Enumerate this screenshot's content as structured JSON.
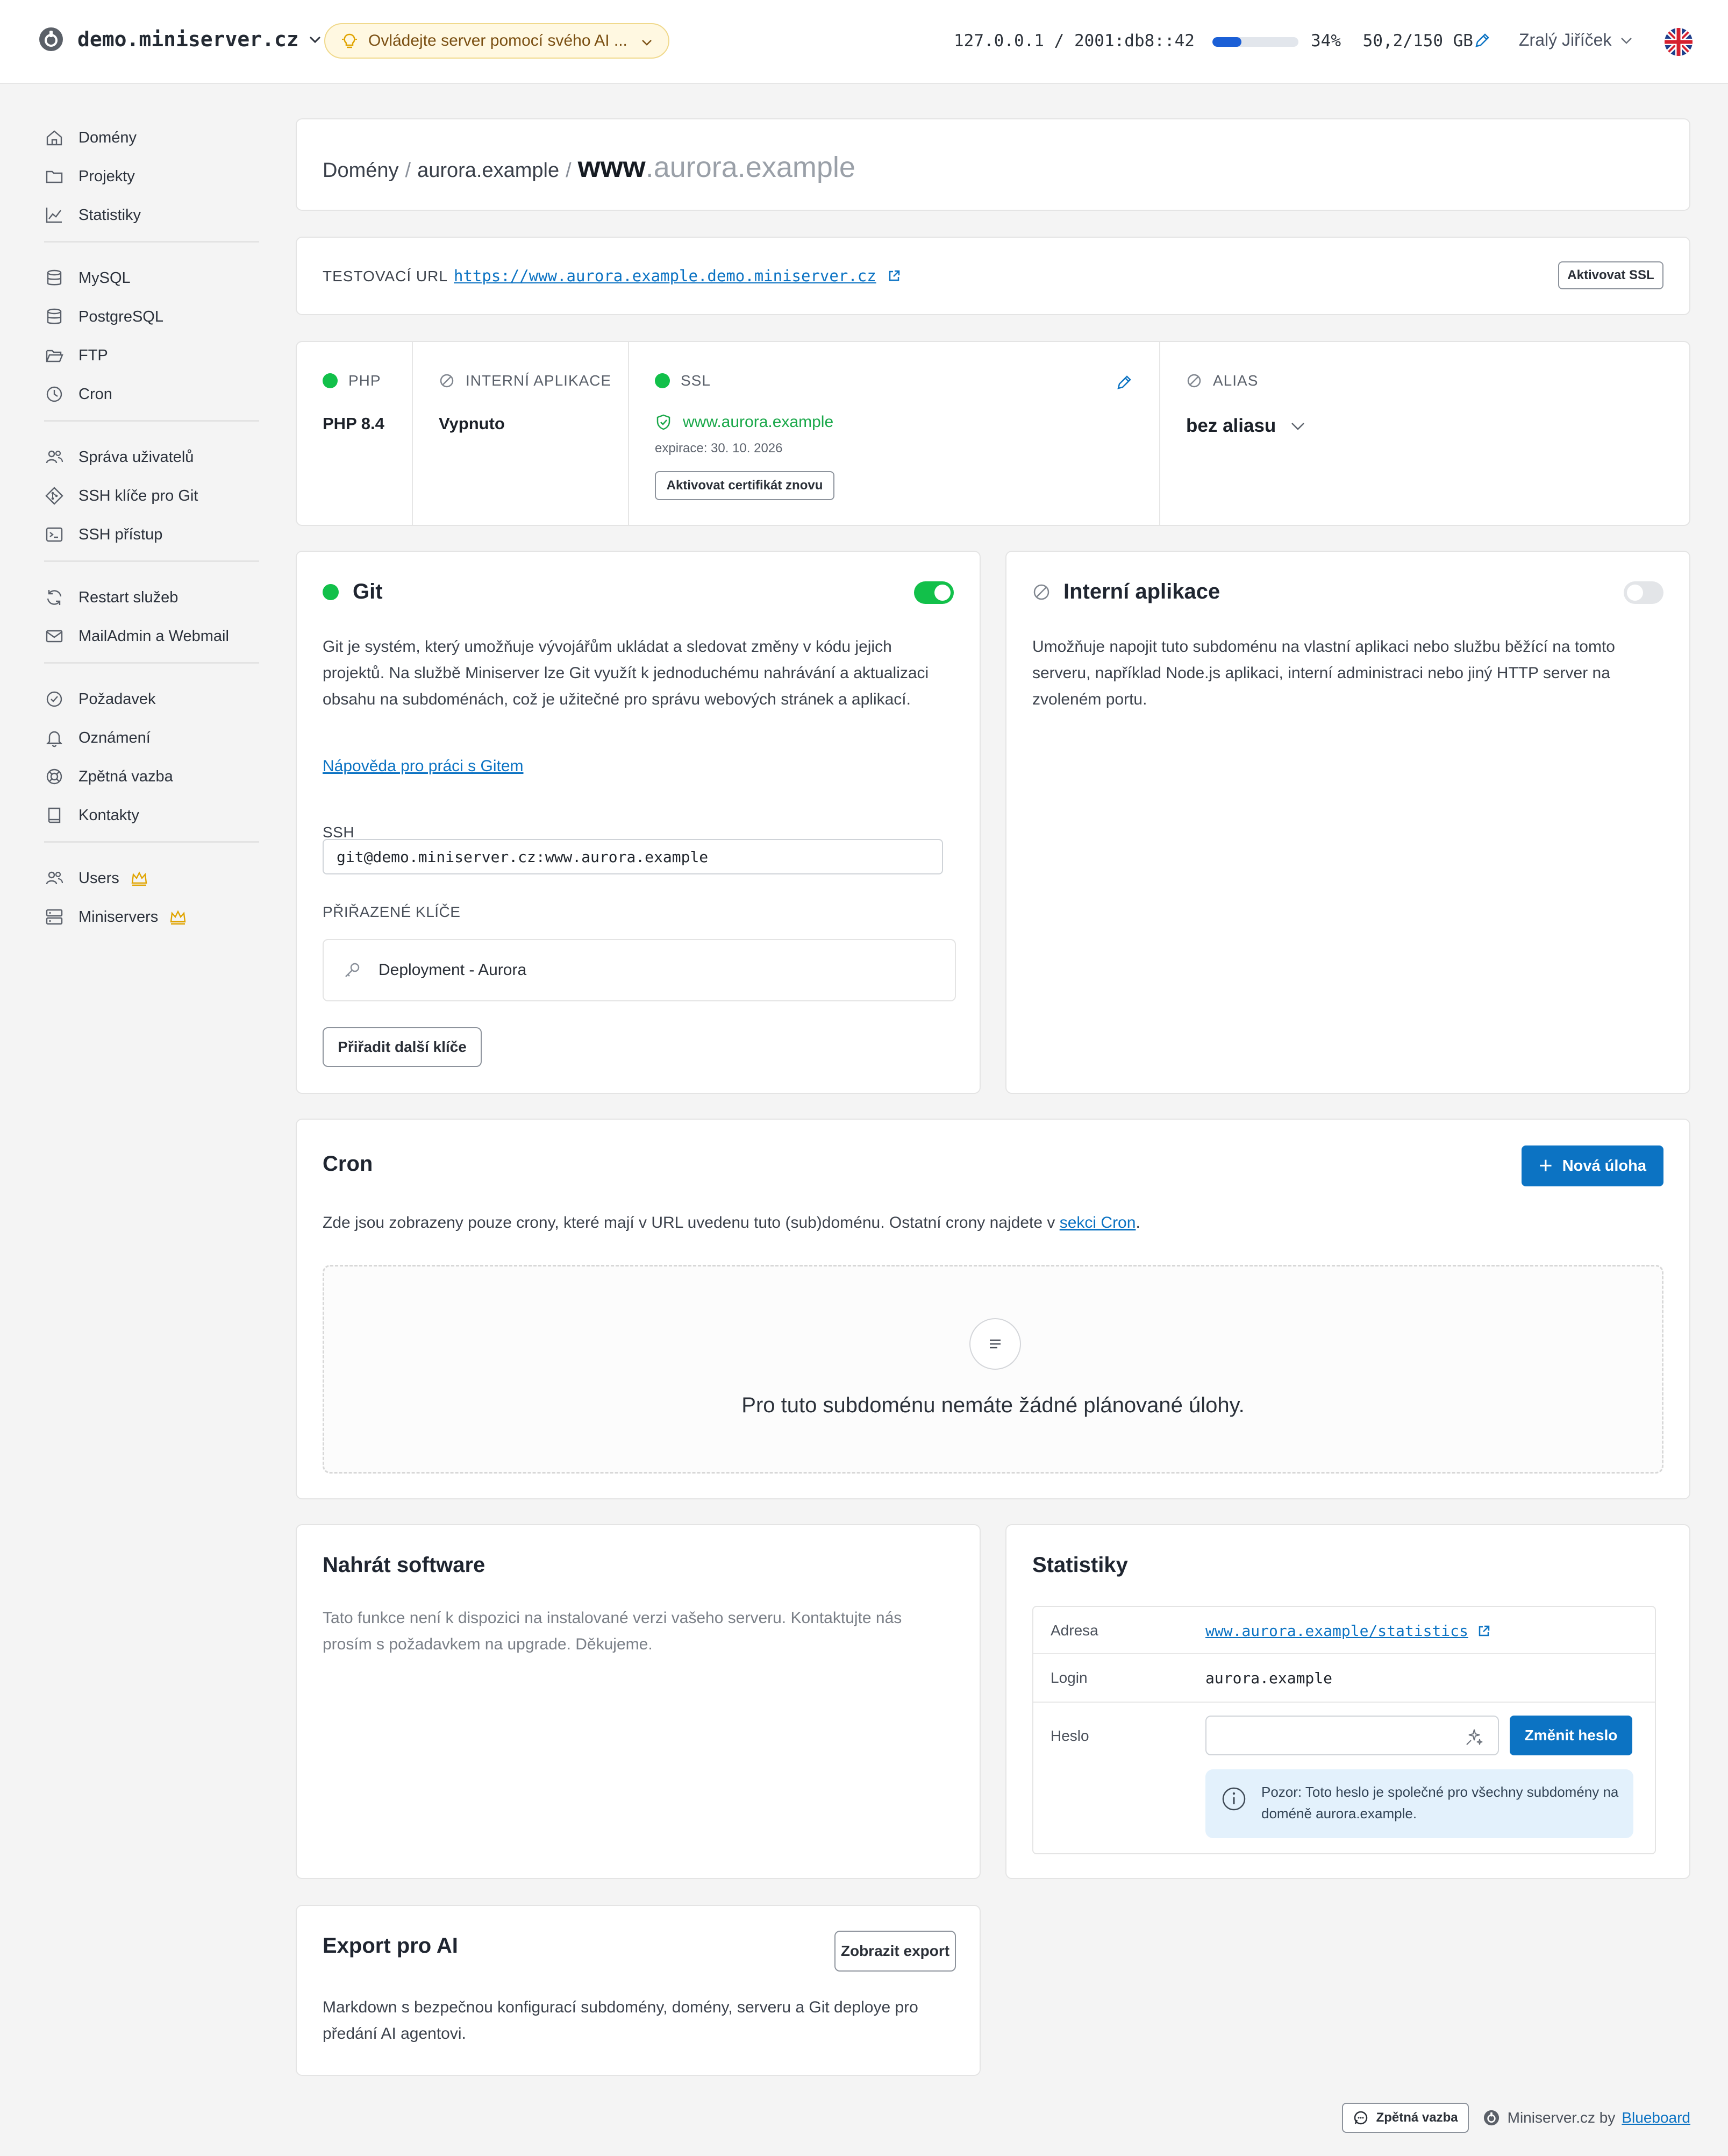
{
  "header": {
    "server_name": "demo.miniserver.cz",
    "ai_banner": "Ovládejte server pomocí svého AI ...",
    "ip": "127.0.0.1 / 2001:db8::42",
    "disk_percent": 34,
    "disk_percent_label": "34%",
    "disk_usage": "50,2/150 GB",
    "user_name": "Zralý Jiříček",
    "language_flag": "uk-flag-icon"
  },
  "sidebar": {
    "groups": [
      [
        {
          "label": "Domény",
          "icon": "home-icon"
        },
        {
          "label": "Projekty",
          "icon": "folder-icon"
        },
        {
          "label": "Statistiky",
          "icon": "chart-icon"
        }
      ],
      [
        {
          "label": "MySQL",
          "icon": "database-icon"
        },
        {
          "label": "PostgreSQL",
          "icon": "database-icon"
        },
        {
          "label": "FTP",
          "icon": "folder-open-icon"
        },
        {
          "label": "Cron",
          "icon": "clock-icon"
        }
      ],
      [
        {
          "label": "Správa uživatelů",
          "icon": "users-icon"
        },
        {
          "label": "SSH klíče pro Git",
          "icon": "git-icon"
        },
        {
          "label": "SSH přístup",
          "icon": "terminal-icon"
        }
      ],
      [
        {
          "label": "Restart služeb",
          "icon": "refresh-icon"
        },
        {
          "label": "MailAdmin a Webmail",
          "icon": "mail-icon"
        }
      ],
      [
        {
          "label": "Požadavek",
          "icon": "check-circle-icon"
        },
        {
          "label": "Oznámení",
          "icon": "bell-icon"
        },
        {
          "label": "Zpětná vazba",
          "icon": "lifebuoy-icon"
        },
        {
          "label": "Kontakty",
          "icon": "book-icon"
        }
      ],
      [
        {
          "label": "Users",
          "icon": "users-icon",
          "premium": true
        },
        {
          "label": "Miniservers",
          "icon": "server-icon",
          "premium": true
        }
      ]
    ]
  },
  "breadcrumb": {
    "root": "Domény",
    "domain": "aurora.example",
    "sub": "www",
    "sub_rest": ".aurora.example"
  },
  "test_url": {
    "label": "TESTOVACÍ URL",
    "url": "https://www.aurora.example.demo.miniserver.cz",
    "ssl_button": "Aktivovat SSL"
  },
  "status": {
    "php": {
      "label": "PHP",
      "value": "PHP 8.4"
    },
    "internal_app": {
      "label": "INTERNÍ APLIKACE",
      "value": "Vypnuto"
    },
    "ssl": {
      "label": "SSL",
      "domain": "www.aurora.example",
      "expiry": "expirace: 30. 10. 2026",
      "renew_button": "Aktivovat certifikát znovu"
    },
    "alias": {
      "label": "ALIAS",
      "value": "bez aliasu"
    }
  },
  "git": {
    "title": "Git",
    "enabled": true,
    "description": "Git je systém, který umožňuje vývojářům ukládat a sledovat změny v kódu jejich projektů. Na službě Miniserver lze Git využít k jednoduchému nahrávání a aktualizaci obsahu na subdoménách, což je užitečné pro správu webových stránek a aplikací.",
    "help_link": "Nápověda pro práci s Gitem",
    "ssh_label": "SSH",
    "ssh_value": "git@demo.miniserver.cz:www.aurora.example",
    "keys_label": "PŘIŘAZENÉ KLÍČE",
    "keys": [
      "Deployment - Aurora"
    ],
    "assign_button": "Přiřadit další klíče"
  },
  "internal_app": {
    "title": "Interní aplikace",
    "enabled": false,
    "description": "Umožňuje napojit tuto subdoménu na vlastní aplikaci nebo službu běžící na tomto serveru, například Node.js aplikaci, interní administraci nebo jiný HTTP server na zvoleném portu."
  },
  "cron": {
    "title": "Cron",
    "new_button": "Nová úloha",
    "info_prefix": "Zde jsou zobrazeny pouze crony, které mají v URL uvedenu tuto (sub)doménu. Ostatní crony najdete v ",
    "info_link": "sekci Cron",
    "info_suffix": ".",
    "empty_text": "Pro tuto subdoménu nemáte žádné plánované úlohy."
  },
  "software": {
    "title": "Nahrát software",
    "text": "Tato funkce není k dispozici na instalované verzi vašeho serveru. Kontaktujte nás prosím s požadavkem na upgrade. Děkujeme."
  },
  "stats": {
    "title": "Statistiky",
    "address_label": "Adresa",
    "address_value": "www.aurora.example/statistics",
    "login_label": "Login",
    "login_value": "aurora.example",
    "password_label": "Heslo",
    "password_value": "",
    "change_button": "Změnit heslo",
    "note": "Pozor: Toto heslo je společné pro všechny subdomény na doméně aurora.example."
  },
  "export": {
    "title": "Export pro AI",
    "button": "Zobrazit export",
    "text": "Markdown s bezpečnou konfigurací subdomény, domény, serveru a Git deploye pro předání AI agentovi."
  },
  "footer": {
    "feedback_button": "Zpětná vazba",
    "credit": "Miniserver.cz by",
    "credit_link": "Blueboard"
  },
  "colors": {
    "accent": "#0c73c3",
    "success": "#12c04a",
    "premium": "#e0a400",
    "banner_bg": "#fff8e1"
  }
}
